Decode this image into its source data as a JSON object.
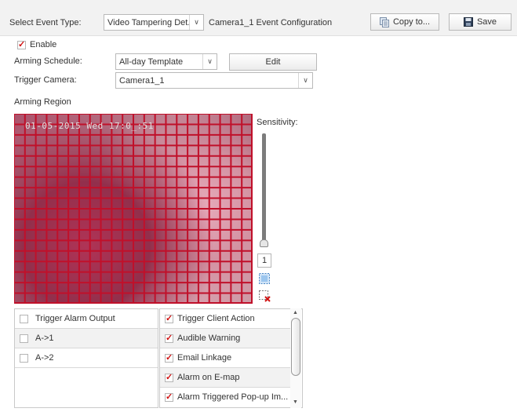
{
  "header": {
    "event_type_label": "Select Event Type:",
    "event_type_value": "Video Tampering Det...",
    "config_title": "Camera1_1 Event Configuration",
    "copy_label": "Copy to...",
    "save_label": "Save"
  },
  "form": {
    "enable_label": "Enable",
    "enable_checked": true,
    "arming_schedule_label": "Arming Schedule:",
    "arming_schedule_value": "All-day Template",
    "edit_label": "Edit",
    "trigger_camera_label": "Trigger Camera:",
    "trigger_camera_value": "Camera1_1",
    "arming_region_label": "Arming Region"
  },
  "video": {
    "osd_text": "01-05-2015 Wed 17:0_:51"
  },
  "sensitivity": {
    "label": "Sensitivity:",
    "value": "1",
    "select_all_icon": "select-all-icon",
    "clear_icon": "clear-region-icon"
  },
  "alarm_outputs": {
    "header": "Trigger Alarm Output",
    "items": [
      {
        "label": "A->1",
        "checked": false
      },
      {
        "label": "A->2",
        "checked": false
      }
    ]
  },
  "linkage_actions": [
    {
      "label": "Trigger Client Action",
      "checked": true
    },
    {
      "label": "Audible Warning",
      "checked": true
    },
    {
      "label": "Email Linkage",
      "checked": true
    },
    {
      "label": "Alarm on E-map",
      "checked": true
    },
    {
      "label": "Alarm Triggered Pop-up Im...",
      "checked": true
    }
  ],
  "colors": {
    "accent_red": "#d01010",
    "grid_red": "#c0102a"
  }
}
